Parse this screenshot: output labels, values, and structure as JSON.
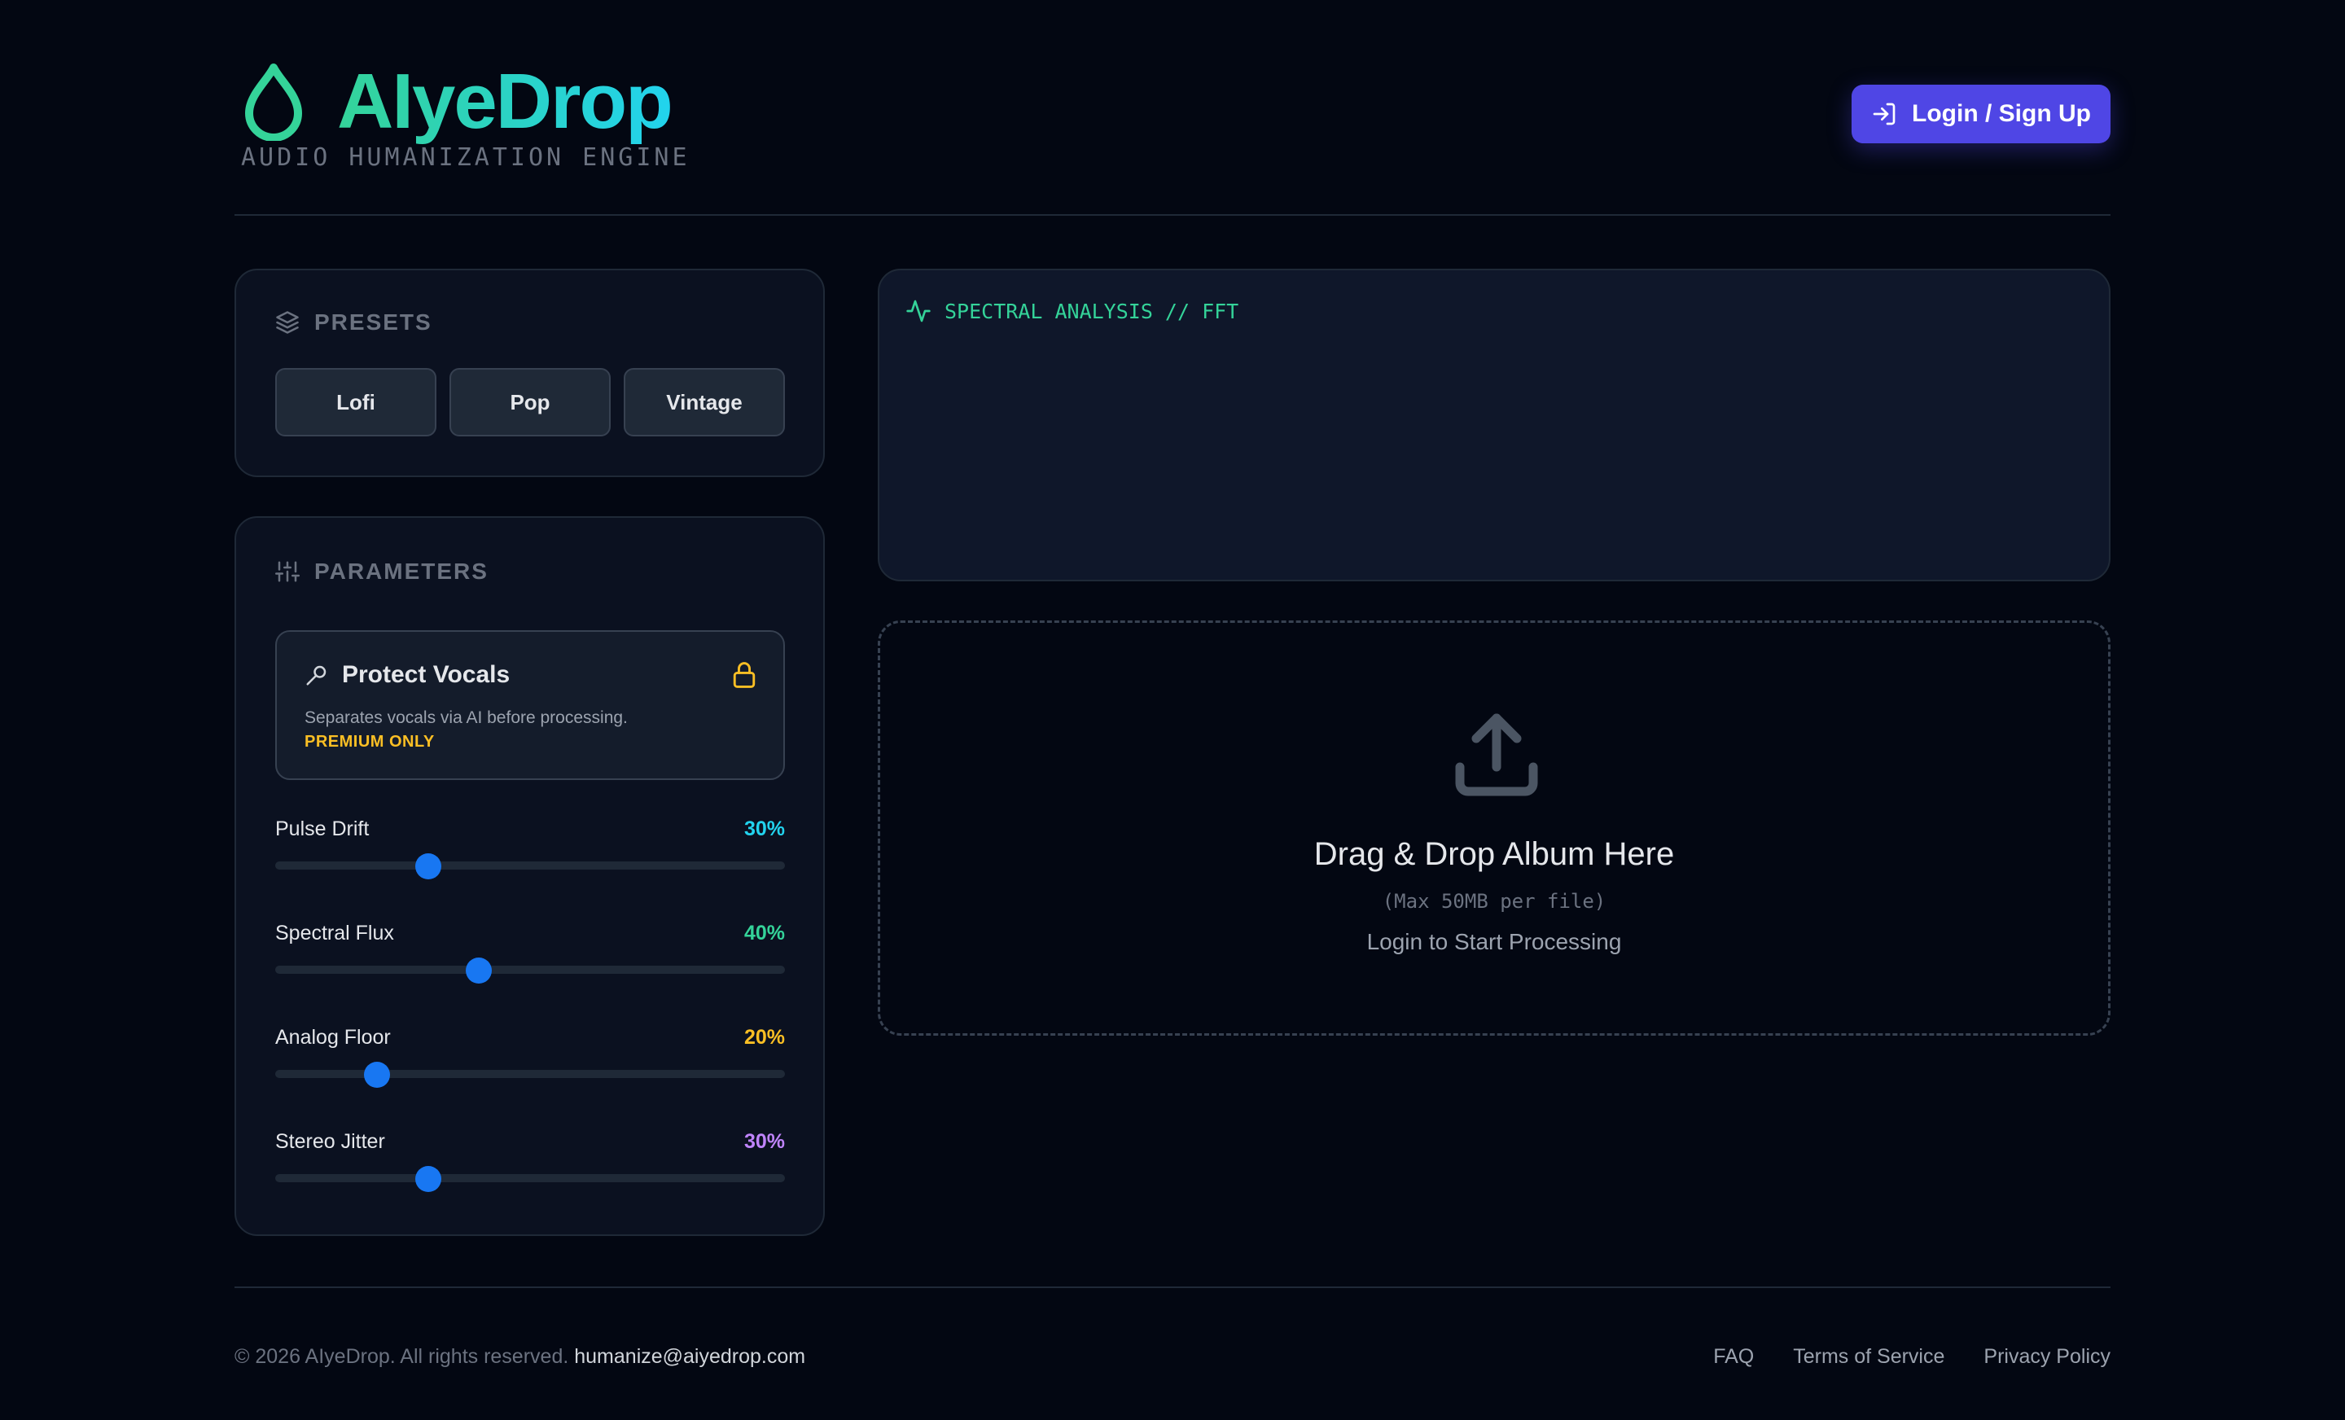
{
  "header": {
    "title": "AIyeDrop",
    "subtitle": "AUDIO HUMANIZATION ENGINE",
    "login_label": "Login / Sign Up"
  },
  "presets": {
    "title": "PRESETS",
    "items": [
      "Lofi",
      "Pop",
      "Vintage"
    ]
  },
  "parameters": {
    "title": "PARAMETERS",
    "protect_vocals": {
      "title": "Protect Vocals",
      "description": "Separates vocals via AI before processing.",
      "badge": "PREMIUM ONLY"
    },
    "sliders": [
      {
        "label": "Pulse Drift",
        "value_text": "30%",
        "value": 30,
        "color": "#22d3ee"
      },
      {
        "label": "Spectral Flux",
        "value_text": "40%",
        "value": 40,
        "color": "#34d399"
      },
      {
        "label": "Analog Floor",
        "value_text": "20%",
        "value": 20,
        "color": "#fbbf24"
      },
      {
        "label": "Stereo Jitter",
        "value_text": "30%",
        "value": 30,
        "color": "#c084fc"
      }
    ]
  },
  "spectral": {
    "title": "SPECTRAL ANALYSIS // FFT"
  },
  "dropzone": {
    "title": "Drag & Drop Album Here",
    "max_size": "(Max 50MB per file)",
    "login_prompt": "Login to Start Processing"
  },
  "footer": {
    "copyright": "© 2026 AIyeDrop. All rights reserved.",
    "email": "humanize@aiyedrop.com",
    "links": [
      "FAQ",
      "Terms of Service",
      "Privacy Policy"
    ]
  },
  "colors": {
    "accent": "#4f46e5",
    "brand_green": "#34d399",
    "brand_cyan": "#22d3ee",
    "slider_thumb": "#1877f2",
    "premium": "#fbbf24"
  }
}
